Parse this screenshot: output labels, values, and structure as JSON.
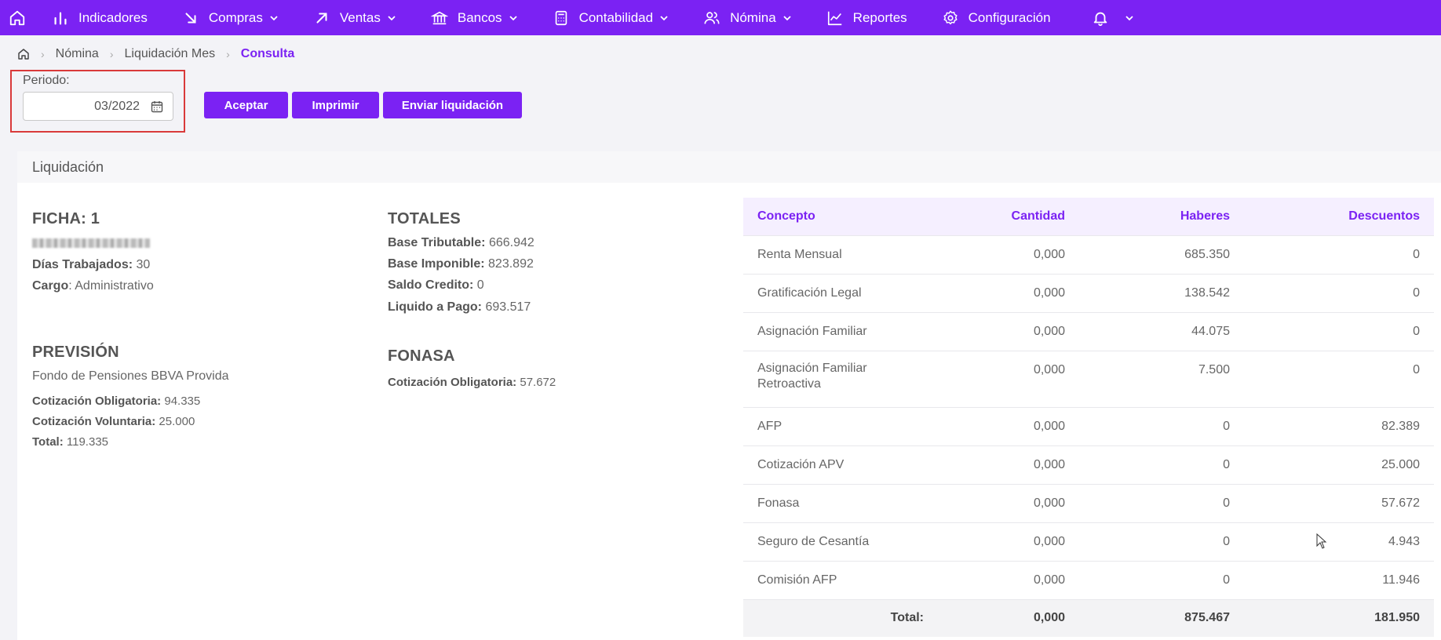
{
  "nav": {
    "items": [
      {
        "label": "Indicadores",
        "icon": "bar-chart-icon",
        "dropdown": false
      },
      {
        "label": "Compras",
        "icon": "arrow-down-right-icon",
        "dropdown": true
      },
      {
        "label": "Ventas",
        "icon": "arrow-up-right-icon",
        "dropdown": true
      },
      {
        "label": "Bancos",
        "icon": "bank-icon",
        "dropdown": true
      },
      {
        "label": "Contabilidad",
        "icon": "calculator-icon",
        "dropdown": true
      },
      {
        "label": "Nómina",
        "icon": "users-icon",
        "dropdown": true
      },
      {
        "label": "Reportes",
        "icon": "line-chart-icon",
        "dropdown": false
      },
      {
        "label": "Configuración",
        "icon": "gear-icon",
        "dropdown": false
      }
    ],
    "accent": "#7b22f3"
  },
  "breadcrumb": {
    "items": [
      "Nómina",
      "Liquidación Mes"
    ],
    "active": "Consulta"
  },
  "period": {
    "label": "Periodo:",
    "value": "03/2022"
  },
  "buttons": {
    "accept": "Aceptar",
    "print": "Imprimir",
    "send": "Enviar liquidación"
  },
  "card": {
    "title": "Liquidación",
    "ficha": {
      "title": "FICHA: 1",
      "dias_label": "Días Trabajados:",
      "dias_value": "30",
      "cargo_label": "Cargo",
      "cargo_value": ": Administrativo"
    },
    "prevision": {
      "title": "PREVISIÓN",
      "fondo": "Fondo de Pensiones BBVA Provida",
      "oblig_label": "Cotización Obligatoria:",
      "oblig_value": "94.335",
      "vol_label": "Cotización Voluntaria:",
      "vol_value": "25.000",
      "total_label": "Total:",
      "total_value": "119.335"
    },
    "totales": {
      "title": "TOTALES",
      "tributable_label": "Base Tributable:",
      "tributable_value": "666.942",
      "imponible_label": "Base Imponible:",
      "imponible_value": "823.892",
      "saldo_label": "Saldo Credito:",
      "saldo_value": "0",
      "liquido_label": "Liquido a Pago:",
      "liquido_value": "693.517"
    },
    "fonasa": {
      "title": "FONASA",
      "oblig_label": "Cotización Obligatoria:",
      "oblig_value": "57.672"
    }
  },
  "table": {
    "headers": [
      "Concepto",
      "Cantidad",
      "Haberes",
      "Descuentos"
    ],
    "rows": [
      [
        "Renta Mensual",
        "0,000",
        "685.350",
        "0"
      ],
      [
        "Gratificación Legal",
        "0,000",
        "138.542",
        "0"
      ],
      [
        "Asignación Familiar",
        "0,000",
        "44.075",
        "0"
      ],
      [
        "Asignación Familiar Retroactiva",
        "0,000",
        "7.500",
        "0"
      ],
      [
        "AFP",
        "0,000",
        "0",
        "82.389"
      ],
      [
        "Cotización APV",
        "0,000",
        "0",
        "25.000"
      ],
      [
        "Fonasa",
        "0,000",
        "0",
        "57.672"
      ],
      [
        "Seguro de Cesantía",
        "0,000",
        "0",
        "4.943"
      ],
      [
        "Comisión AFP",
        "0,000",
        "0",
        "11.946"
      ]
    ],
    "total": [
      "Total:",
      "0,000",
      "875.467",
      "181.950"
    ]
  }
}
